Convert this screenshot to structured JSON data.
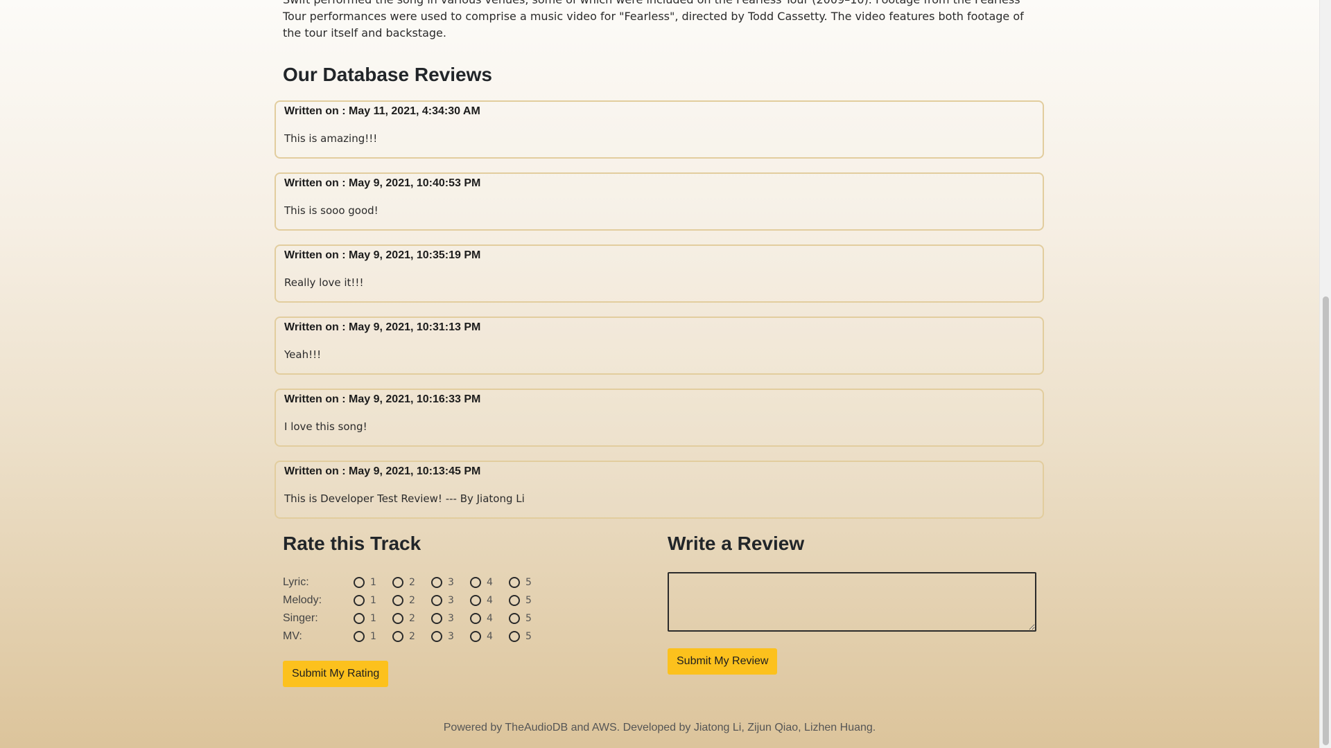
{
  "intro": {
    "text": "Swift performed the song in various venues, some of which were included on the Fearless Tour (2009–10). Footage from the Fearless Tour performances were used to comprise a music video for \"Fearless\", directed by Todd Cassetty. The video features both footage of the tour itself and backstage."
  },
  "reviews_section": {
    "title": "Our Database Reviews",
    "written_prefix": "Written on : ",
    "items": [
      {
        "date": "May 11, 2021, 4:34:30 AM",
        "text": "This is amazing!!!"
      },
      {
        "date": "May 9, 2021, 10:40:53 PM",
        "text": "This is sooo good!"
      },
      {
        "date": "May 9, 2021, 10:35:19 PM",
        "text": "Really love it!!!"
      },
      {
        "date": "May 9, 2021, 10:31:13 PM",
        "text": "Yeah!!!"
      },
      {
        "date": "May 9, 2021, 10:16:33 PM",
        "text": "I love this song!"
      },
      {
        "date": "May 9, 2021, 10:13:45 PM",
        "text": "This is Developer Test Review! --- By Jiatong Li"
      }
    ]
  },
  "rating": {
    "title": "Rate this Track",
    "categories": [
      "Lyric:",
      "Melody:",
      "Singer:",
      "MV:"
    ],
    "options": [
      "1",
      "2",
      "3",
      "4",
      "5"
    ],
    "submit_label": "Submit My Rating"
  },
  "write_review": {
    "title": "Write a Review",
    "textarea_value": "",
    "submit_label": "Submit My Review"
  },
  "footer": {
    "text": "Powered by TheAudioDB and AWS. Developed by Jiatong Li, Zijun Qiao, Lizhen Huang."
  },
  "colors": {
    "button_bg": "#fcc11d",
    "card_border": "#e2cd9e",
    "gradient_top": "#fcfbf8",
    "gradient_bottom": "#dcc49b"
  }
}
